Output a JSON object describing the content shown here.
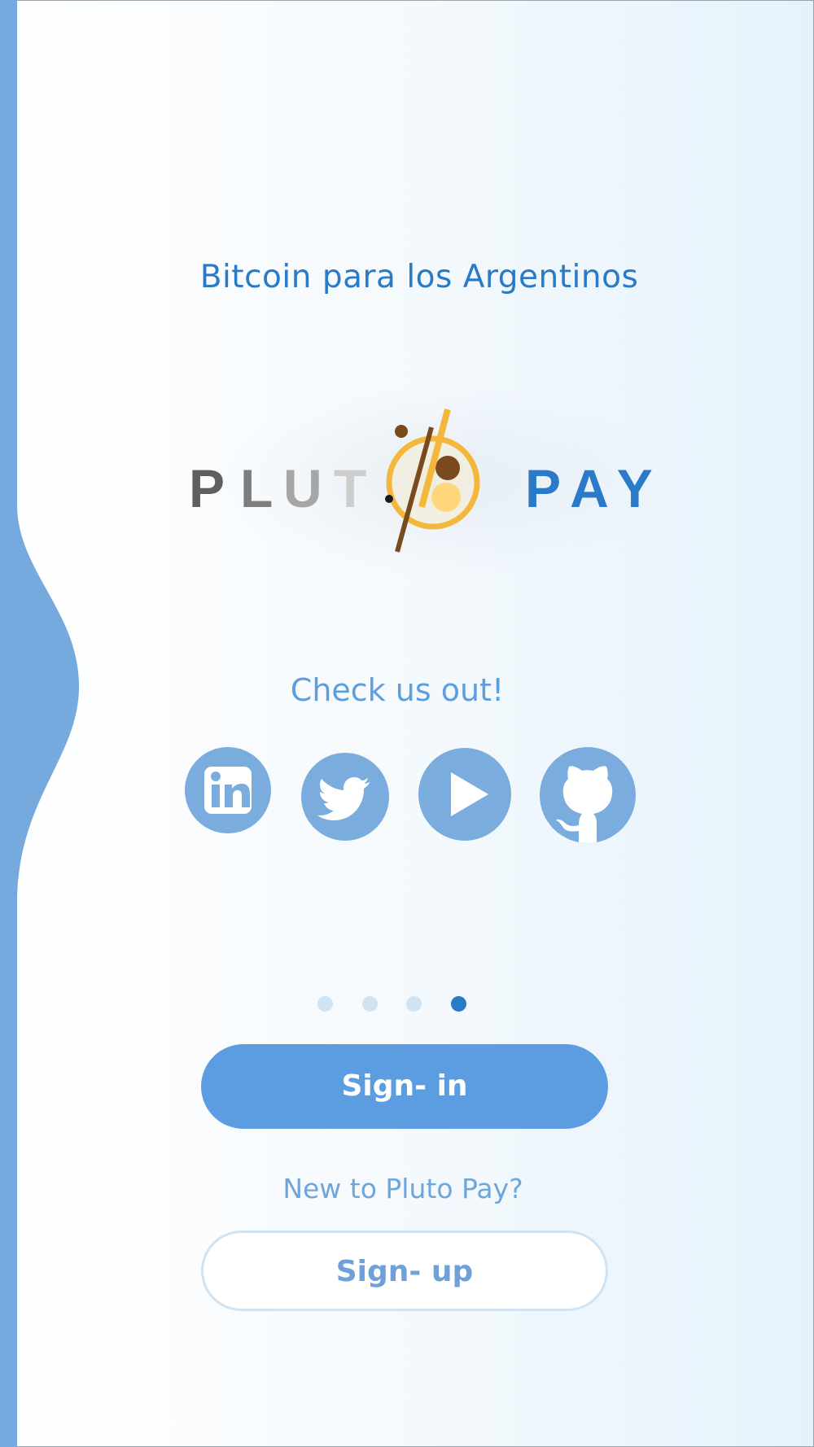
{
  "tagline": "Bitcoin para los Argentinos",
  "logo": {
    "word_left": "PLUTO",
    "word_right": "PAY",
    "icon": "pluto-coin-logo"
  },
  "social": {
    "heading": "Check us out!",
    "items": [
      {
        "name": "linkedin",
        "icon": "linkedin-icon"
      },
      {
        "name": "twitter",
        "icon": "twitter-icon"
      },
      {
        "name": "youtube",
        "icon": "play-icon"
      },
      {
        "name": "github",
        "icon": "github-icon"
      }
    ]
  },
  "pager": {
    "total": 4,
    "active_index": 3
  },
  "buttons": {
    "signin": "Sign- in",
    "signup": "Sign- up"
  },
  "prompt": "New to Pluto Pay?",
  "colors": {
    "accent": "#2a7ac7",
    "button": "#5b9de0",
    "social": "#7aacde",
    "sidebar": "#76a9dd",
    "logo_gold": "#f3b73c",
    "logo_brown": "#7a4a1f"
  }
}
